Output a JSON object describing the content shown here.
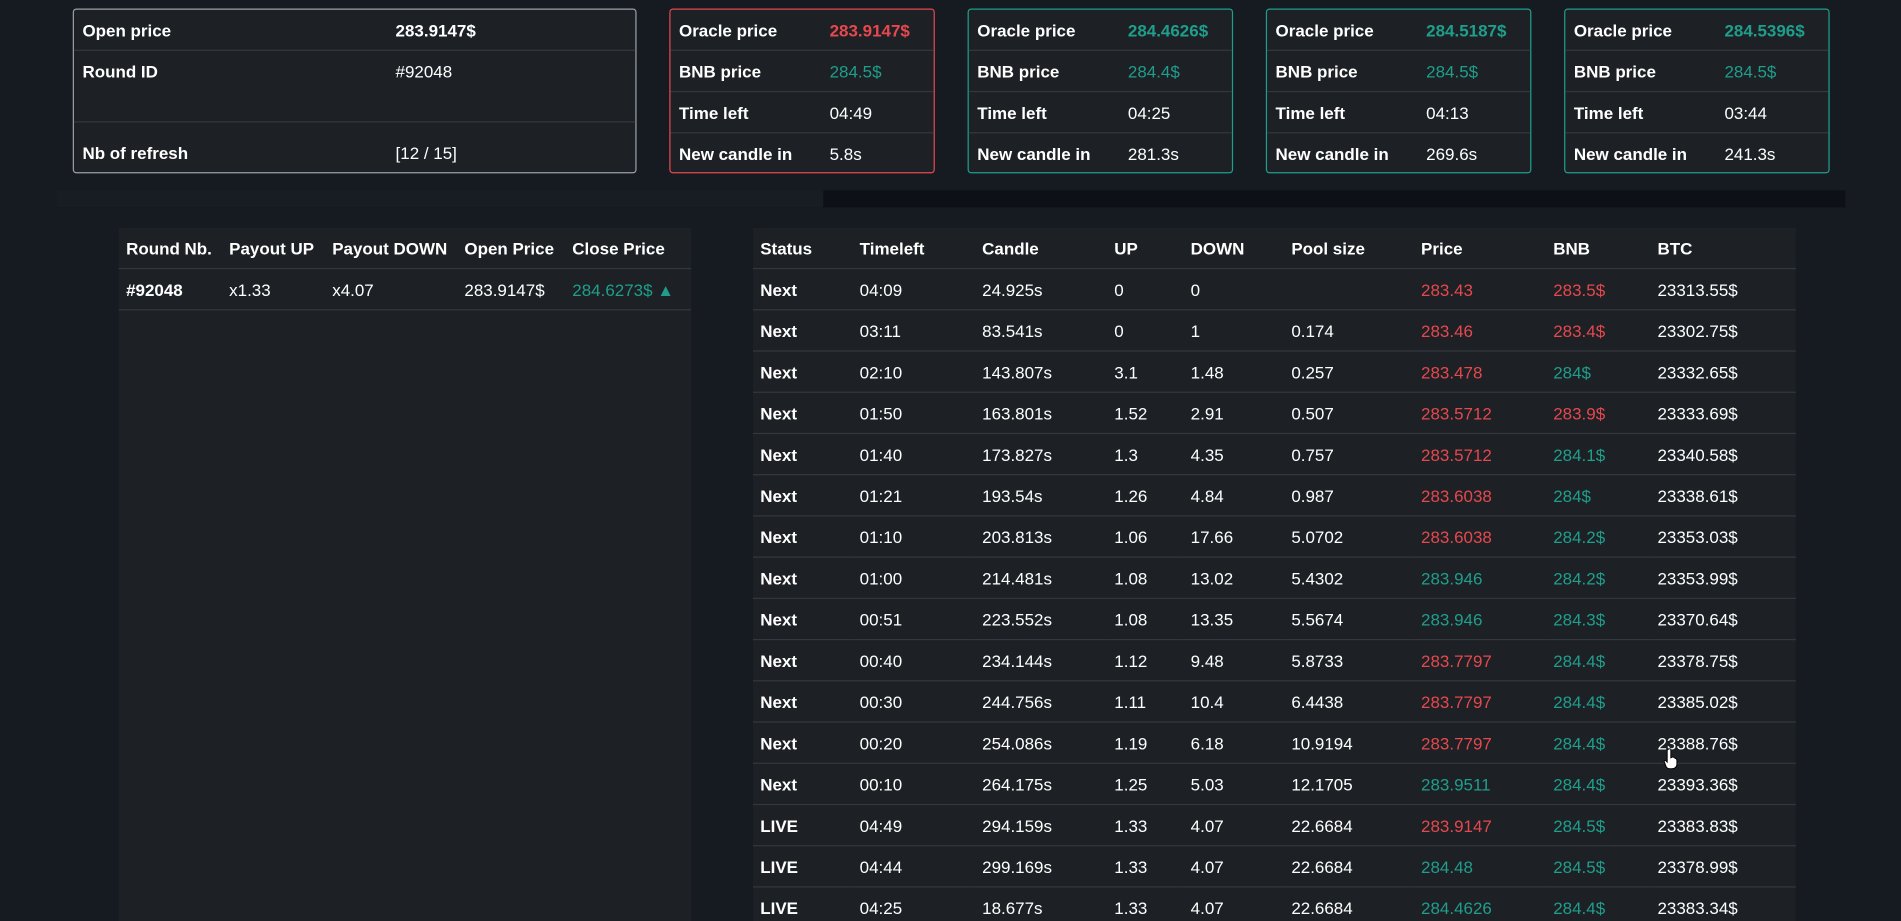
{
  "info_card": {
    "open_price_label": "Open price",
    "open_price_value": "283.9147$",
    "round_id_label": "Round ID",
    "round_id_value": "#92048",
    "refresh_label": "Nb of refresh",
    "refresh_value": "[12 / 15]"
  },
  "oracle_cards": [
    {
      "oracle_label": "Oracle price",
      "oracle_value": "283.9147$",
      "oracle_color": "#e5484d",
      "bnb_label": "BNB price",
      "bnb_value": "284.5$",
      "time_label": "Time left",
      "time_value": "04:49",
      "candle_label": "New candle in",
      "candle_value": "5.8s",
      "border": "red"
    },
    {
      "oracle_label": "Oracle price",
      "oracle_value": "284.4626$",
      "oracle_color": "#1f9e8c",
      "bnb_label": "BNB price",
      "bnb_value": "284.4$",
      "time_label": "Time left",
      "time_value": "04:25",
      "candle_label": "New candle in",
      "candle_value": "281.3s",
      "border": "green"
    },
    {
      "oracle_label": "Oracle price",
      "oracle_value": "284.5187$",
      "oracle_color": "#1f9e8c",
      "bnb_label": "BNB price",
      "bnb_value": "284.5$",
      "time_label": "Time left",
      "time_value": "04:13",
      "candle_label": "New candle in",
      "candle_value": "269.6s",
      "border": "green"
    },
    {
      "oracle_label": "Oracle price",
      "oracle_value": "284.5396$",
      "oracle_color": "#1f9e8c",
      "bnb_label": "BNB price",
      "bnb_value": "284.5$",
      "time_label": "Time left",
      "time_value": "03:44",
      "candle_label": "New candle in",
      "candle_value": "241.3s",
      "border": "green"
    }
  ],
  "rounds_table": {
    "headers": [
      "Round Nb.",
      "Payout UP",
      "Payout DOWN",
      "Open Price",
      "Close Price"
    ],
    "rows": [
      {
        "round": "#92048",
        "payout_up": "x1.33",
        "payout_down": "x4.07",
        "open_price": "283.9147$",
        "close_price": "284.6273$ ▲"
      }
    ]
  },
  "history_table": {
    "headers": [
      "Status",
      "Timeleft",
      "Candle",
      "UP",
      "DOWN",
      "Pool size",
      "Price",
      "BNB",
      "BTC"
    ],
    "rows": [
      {
        "status": "Next",
        "timeleft": "04:09",
        "candle": "24.925s",
        "up": "0",
        "down": "0",
        "pool": "",
        "price": "283.43",
        "price_color": "red",
        "bnb": "283.5$",
        "bnb_color": "red",
        "btc": "23313.55$"
      },
      {
        "status": "Next",
        "timeleft": "03:11",
        "candle": "83.541s",
        "up": "0",
        "down": "1",
        "pool": "0.174",
        "price": "283.46",
        "price_color": "red",
        "bnb": "283.4$",
        "bnb_color": "red",
        "btc": "23302.75$"
      },
      {
        "status": "Next",
        "timeleft": "02:10",
        "candle": "143.807s",
        "up": "3.1",
        "down": "1.48",
        "pool": "0.257",
        "price": "283.478",
        "price_color": "red",
        "bnb": "284$",
        "bnb_color": "green",
        "btc": "23332.65$"
      },
      {
        "status": "Next",
        "timeleft": "01:50",
        "candle": "163.801s",
        "up": "1.52",
        "down": "2.91",
        "pool": "0.507",
        "price": "283.5712",
        "price_color": "red",
        "bnb": "283.9$",
        "bnb_color": "red",
        "btc": "23333.69$"
      },
      {
        "status": "Next",
        "timeleft": "01:40",
        "candle": "173.827s",
        "up": "1.3",
        "down": "4.35",
        "pool": "0.757",
        "price": "283.5712",
        "price_color": "red",
        "bnb": "284.1$",
        "bnb_color": "green",
        "btc": "23340.58$"
      },
      {
        "status": "Next",
        "timeleft": "01:21",
        "candle": "193.54s",
        "up": "1.26",
        "down": "4.84",
        "pool": "0.987",
        "price": "283.6038",
        "price_color": "red",
        "bnb": "284$",
        "bnb_color": "green",
        "btc": "23338.61$"
      },
      {
        "status": "Next",
        "timeleft": "01:10",
        "candle": "203.813s",
        "up": "1.06",
        "down": "17.66",
        "pool": "5.0702",
        "price": "283.6038",
        "price_color": "red",
        "bnb": "284.2$",
        "bnb_color": "green",
        "btc": "23353.03$"
      },
      {
        "status": "Next",
        "timeleft": "01:00",
        "candle": "214.481s",
        "up": "1.08",
        "down": "13.02",
        "pool": "5.4302",
        "price": "283.946",
        "price_color": "green",
        "bnb": "284.2$",
        "bnb_color": "green",
        "btc": "23353.99$"
      },
      {
        "status": "Next",
        "timeleft": "00:51",
        "candle": "223.552s",
        "up": "1.08",
        "down": "13.35",
        "pool": "5.5674",
        "price": "283.946",
        "price_color": "green",
        "bnb": "284.3$",
        "bnb_color": "green",
        "btc": "23370.64$"
      },
      {
        "status": "Next",
        "timeleft": "00:40",
        "candle": "234.144s",
        "up": "1.12",
        "down": "9.48",
        "pool": "5.8733",
        "price": "283.7797",
        "price_color": "red",
        "bnb": "284.4$",
        "bnb_color": "green",
        "btc": "23378.75$"
      },
      {
        "status": "Next",
        "timeleft": "00:30",
        "candle": "244.756s",
        "up": "1.11",
        "down": "10.4",
        "pool": "6.4438",
        "price": "283.7797",
        "price_color": "red",
        "bnb": "284.4$",
        "bnb_color": "green",
        "btc": "23385.02$"
      },
      {
        "status": "Next",
        "timeleft": "00:20",
        "candle": "254.086s",
        "up": "1.19",
        "down": "6.18",
        "pool": "10.9194",
        "price": "283.7797",
        "price_color": "red",
        "bnb": "284.4$",
        "bnb_color": "green",
        "btc": "23388.76$"
      },
      {
        "status": "Next",
        "timeleft": "00:10",
        "candle": "264.175s",
        "up": "1.25",
        "down": "5.03",
        "pool": "12.1705",
        "price": "283.9511",
        "price_color": "green",
        "bnb": "284.4$",
        "bnb_color": "green",
        "btc": "23393.36$"
      },
      {
        "status": "LIVE",
        "timeleft": "04:49",
        "candle": "294.159s",
        "up": "1.33",
        "down": "4.07",
        "pool": "22.6684",
        "price": "283.9147",
        "price_color": "red",
        "bnb": "284.5$",
        "bnb_color": "green",
        "btc": "23383.83$"
      },
      {
        "status": "LIVE",
        "timeleft": "04:44",
        "candle": "299.169s",
        "up": "1.33",
        "down": "4.07",
        "pool": "22.6684",
        "price": "284.48",
        "price_color": "green",
        "bnb": "284.5$",
        "bnb_color": "green",
        "btc": "23378.99$"
      },
      {
        "status": "LIVE",
        "timeleft": "04:25",
        "candle": "18.677s",
        "up": "1.33",
        "down": "4.07",
        "pool": "22.6684",
        "price": "284.4626",
        "price_color": "green",
        "bnb": "284.4$",
        "bnb_color": "green",
        "btc": "23383.34$"
      }
    ]
  },
  "colors": {
    "red": "#e5484d",
    "green": "#1f9e8c",
    "background": "#161b22",
    "panel": "#1d2125"
  }
}
